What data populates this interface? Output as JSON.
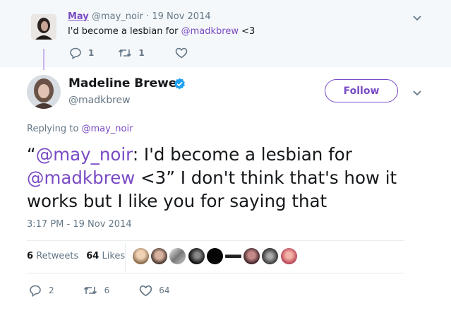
{
  "parent_tweet": {
    "name": "May",
    "handle": "@may_noir",
    "sep": "·",
    "date": "19 Nov 2014",
    "text_pre": "I'd become a lesbian for ",
    "mention": "@madkbrew",
    "text_post": " <3",
    "replies": "1",
    "retweets": "1"
  },
  "main_tweet": {
    "name": "Madeline Brewer",
    "handle": "@madkbrew",
    "follow_label": "Follow",
    "replying_prefix": "Replying to",
    "replying_handle": "@may_noir",
    "quote_open": "“",
    "mention1": "@may_noir",
    "text1": ": I'd become a lesbian for ",
    "mention2": "@madkbrew",
    "text2": " <3” I don't think that's how it works but I like you for saying that",
    "timestamp": "3:17 PM - 19 Nov 2014",
    "retweet_count": "6",
    "retweet_label": "Retweets",
    "like_count": "64",
    "like_label": "Likes",
    "reply_action_count": "2",
    "retweet_action_count": "6",
    "like_action_count": "64"
  },
  "colors": {
    "accent": "#794bc4",
    "verified": "#1da1f2",
    "muted": "#657786"
  },
  "icons": [
    "chevron-down-icon",
    "reply-icon",
    "retweet-icon",
    "heart-icon",
    "verified-badge-icon"
  ]
}
